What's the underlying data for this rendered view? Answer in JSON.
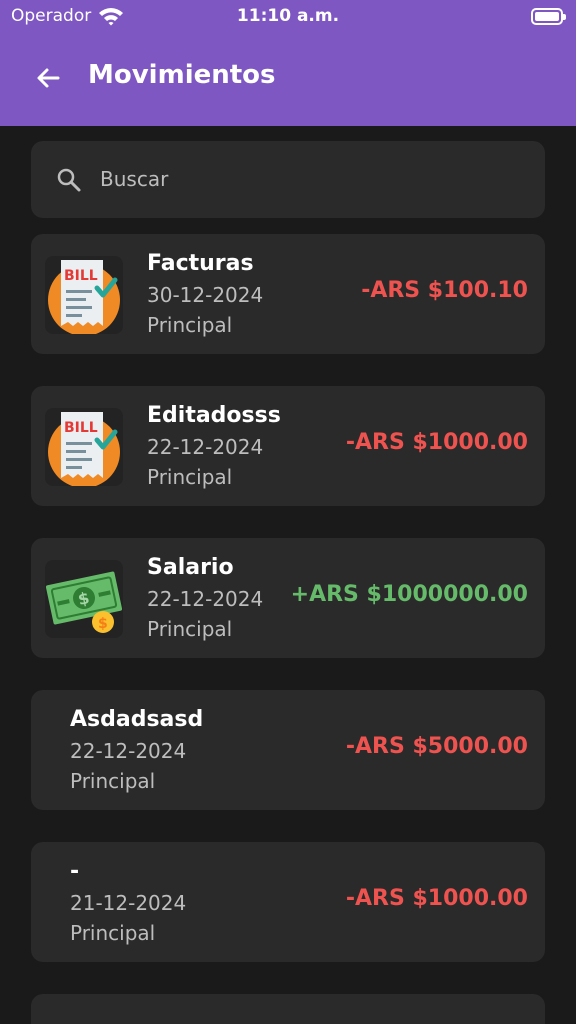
{
  "status_bar": {
    "carrier": "Operador",
    "time": "11:10 a.m."
  },
  "header": {
    "title": "Movimientos",
    "background": "#7e57c2"
  },
  "search": {
    "placeholder": "Buscar"
  },
  "movements": [
    {
      "icon": "bill-icon",
      "title": "Facturas",
      "date": "30-12-2024",
      "account": "Principal",
      "amount": "-ARS $100.10",
      "type": "expense"
    },
    {
      "icon": "bill-icon",
      "title": "Editadosss",
      "date": "22-12-2024",
      "account": "Principal",
      "amount": "-ARS $1000.00",
      "type": "expense"
    },
    {
      "icon": "money-icon",
      "title": "Salario",
      "date": "22-12-2024",
      "account": "Principal",
      "amount": "+ARS $1000000.00",
      "type": "income"
    },
    {
      "icon": "",
      "title": "Asdadsasd",
      "date": "22-12-2024",
      "account": "Principal",
      "amount": "-ARS $5000.00",
      "type": "expense"
    },
    {
      "icon": "",
      "title": "-",
      "date": "21-12-2024",
      "account": "Principal",
      "amount": "-ARS $1000.00",
      "type": "expense"
    }
  ],
  "colors": {
    "expense": "#ef5350",
    "income": "#66bb6a",
    "card": "#2a2a2a",
    "background": "#1a1a1a"
  }
}
